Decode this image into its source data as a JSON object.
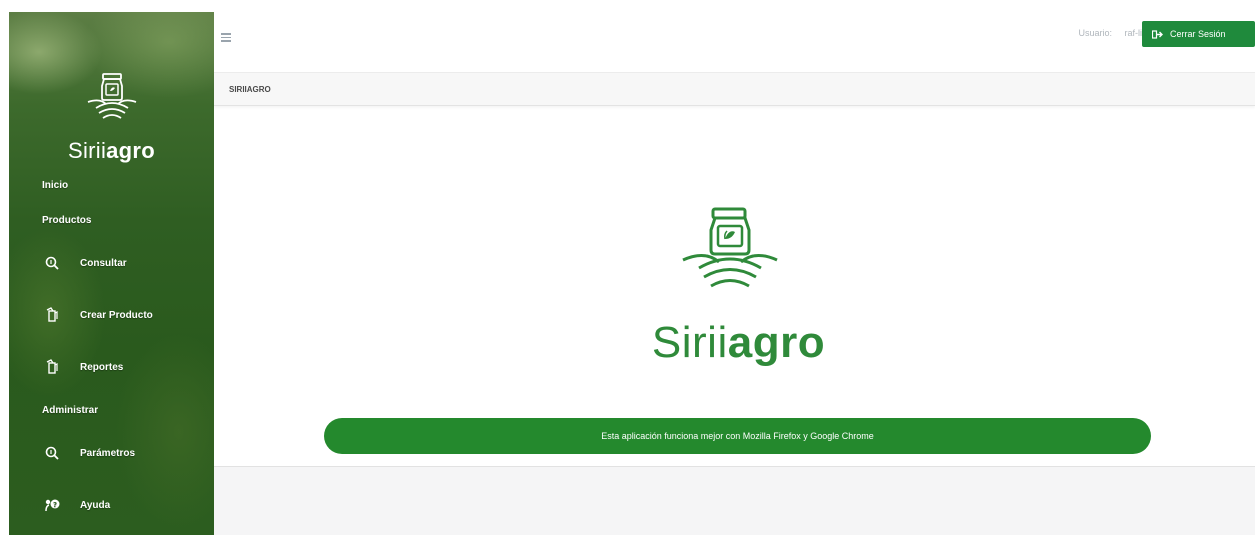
{
  "sidebar": {
    "brand": {
      "thin": "Sirii",
      "bold": "agro"
    },
    "sections": [
      {
        "label": "Inicio"
      },
      {
        "label": "Productos"
      },
      {
        "label": "Administrar"
      }
    ],
    "items": [
      {
        "label": "Consultar",
        "icon": "search-icon"
      },
      {
        "label": "Crear Producto",
        "icon": "product-icon"
      },
      {
        "label": "Reportes",
        "icon": "report-icon"
      },
      {
        "label": "Parámetros",
        "icon": "search-icon"
      },
      {
        "label": "Ayuda",
        "icon": "help-icon"
      }
    ]
  },
  "topbar": {
    "menu_icon": "hamburger-icon",
    "user_label": "Usuario:",
    "user_name": "raf-lin",
    "logout_label": "Cerrar Sesión",
    "logout_icon": "sign-out-icon"
  },
  "breadcrumb": {
    "text": "SIRIIAGRO"
  },
  "main": {
    "brand": {
      "thin": "Sirii",
      "bold": "agro"
    },
    "notice": "Esta aplicación funciona mejor con Mozilla Firefox y Google Chrome"
  },
  "colors": {
    "accent_green": "#1f8a3c",
    "brand_green": "#2f8a3a",
    "notice_green": "#24892d",
    "sidebar_green": "#2f5e22"
  }
}
